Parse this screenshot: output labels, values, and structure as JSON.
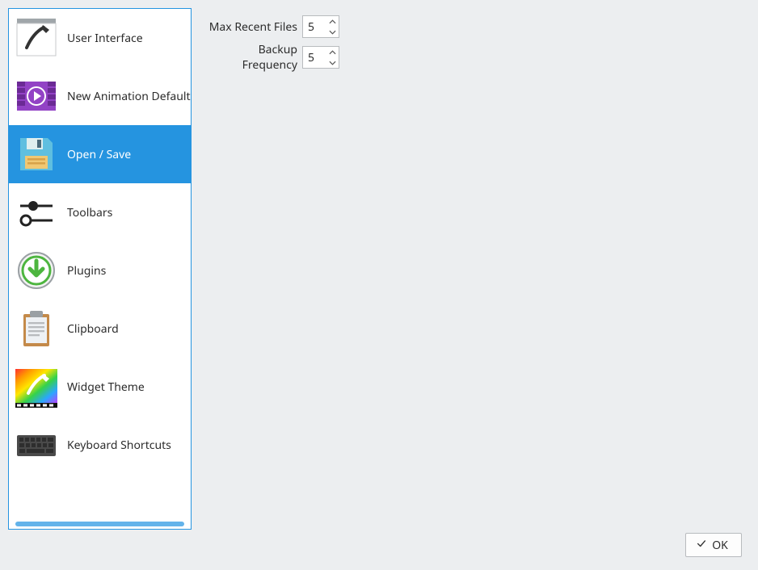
{
  "sidebar": {
    "items": [
      {
        "label": "User Interface"
      },
      {
        "label": "New Animation Defaults"
      },
      {
        "label": "Open / Save"
      },
      {
        "label": "Toolbars"
      },
      {
        "label": "Plugins"
      },
      {
        "label": "Clipboard"
      },
      {
        "label": "Widget Theme"
      },
      {
        "label": "Keyboard Shortcuts"
      }
    ],
    "selected_index": 2
  },
  "content": {
    "max_recent_files": {
      "label": "Max Recent Files",
      "value": "5"
    },
    "backup_frequency": {
      "label": "Backup Frequency",
      "value": "5"
    }
  },
  "footer": {
    "ok_label": "OK"
  }
}
